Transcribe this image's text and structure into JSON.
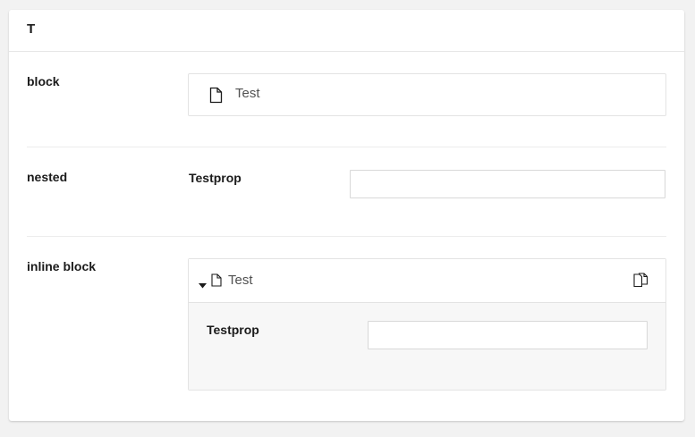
{
  "panel": {
    "title": "T"
  },
  "rows": {
    "block": {
      "label": "block",
      "block_name": "Test",
      "icon": "document-icon"
    },
    "nested": {
      "label": "nested",
      "prop_label": "Testprop",
      "prop_value": ""
    },
    "inline_block": {
      "label": "inline block",
      "block_name": "Test",
      "expand_icon": "caret-down-icon",
      "icon": "document-icon",
      "action_icon": "copy-icon",
      "prop_label": "Testprop",
      "prop_value": ""
    }
  }
}
